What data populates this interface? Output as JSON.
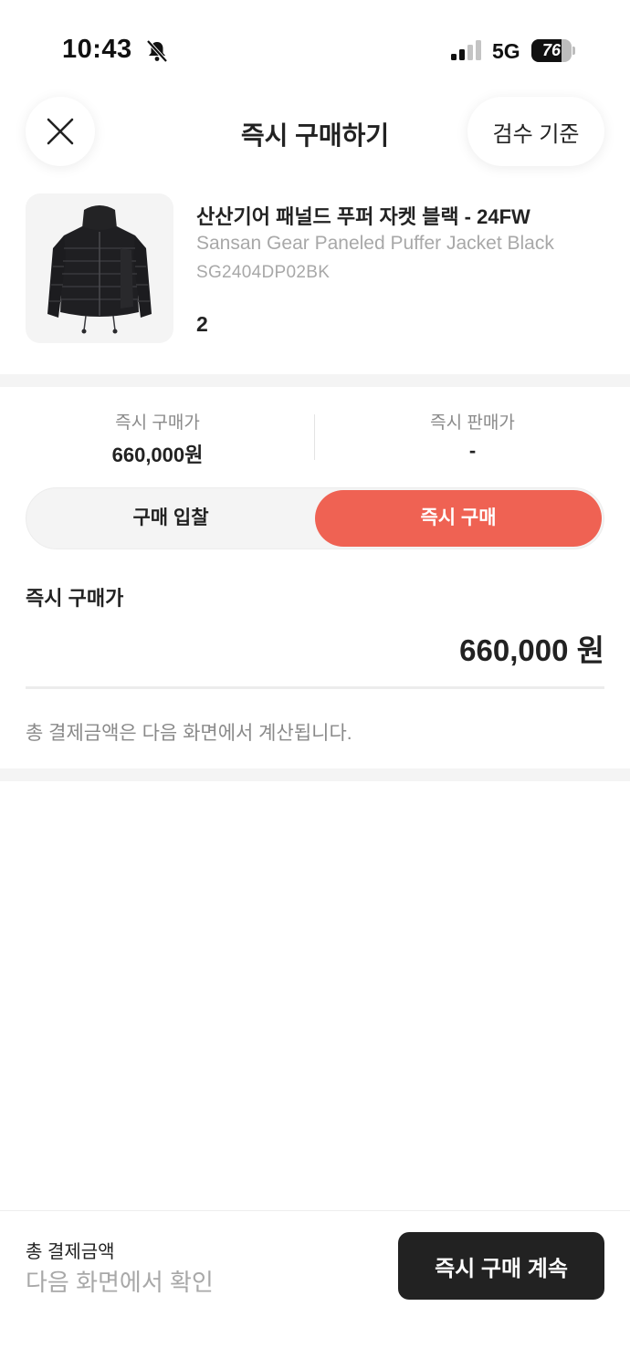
{
  "status_bar": {
    "time": "10:43",
    "network": "5G",
    "battery_percent": "76",
    "battery_level": 0.76
  },
  "header": {
    "title": "즉시 구매하기",
    "criteria_label": "검수 기준"
  },
  "product": {
    "name_ko": "산산기어 패널드 푸퍼 자켓 블랙 - 24FW",
    "name_en": "Sansan Gear Paneled Puffer Jacket Black",
    "code": "SG2404DP02BK",
    "size": "2"
  },
  "prices": {
    "buy_label": "즉시 구매가",
    "buy_value": "660,000원",
    "sell_label": "즉시 판매가",
    "sell_value": "-"
  },
  "segment": {
    "bid_label": "구매 입찰",
    "buy_label": "즉시 구매"
  },
  "instant": {
    "label": "즉시 구매가",
    "value": "660,000 원",
    "note": "총 결제금액은 다음 화면에서 계산됩니다."
  },
  "footer": {
    "total_label": "총 결제금액",
    "total_value": "다음 화면에서 확인",
    "continue_label": "즉시 구매 계속"
  },
  "colors": {
    "accent": "#ef6253",
    "dark_button": "#222222",
    "muted_text": "#8a8a8a",
    "band": "#f4f4f4"
  }
}
